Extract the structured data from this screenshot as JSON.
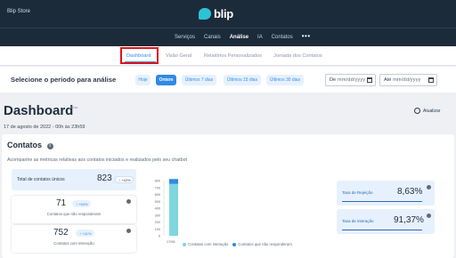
{
  "app": {
    "store_name": "Blip Store",
    "brand": "blip"
  },
  "nav": {
    "items": [
      {
        "label": "Serviços"
      },
      {
        "label": "Canais"
      },
      {
        "label": "Análise"
      },
      {
        "label": "IA"
      },
      {
        "label": "Contatos"
      }
    ],
    "active": "Análise",
    "more": "•••"
  },
  "subtabs": {
    "items": [
      {
        "label": "Dashboard"
      },
      {
        "label": "Visão Geral"
      },
      {
        "label": "Relatórios Personalizados"
      },
      {
        "label": "Jornada dos Contatos"
      }
    ],
    "active": "Dashboard"
  },
  "period": {
    "label": "Selecione o período para análise",
    "chips": [
      {
        "label": "Hoje"
      },
      {
        "label": "Ontem"
      },
      {
        "label": "Últimos 7 dias"
      },
      {
        "label": "Últimos 15 dias"
      },
      {
        "label": "Últimos 30 dias"
      }
    ],
    "active_chip": "Ontem",
    "from_label": "De",
    "from_placeholder": "mm/dd/yyyy",
    "to_label": "Até",
    "to_placeholder": "mm/dd/yyyy"
  },
  "dashboard": {
    "title": "Dashboard",
    "beta": "Beta",
    "date": "17 de agosto de 2022 - 00h às 23h59",
    "refresh_label": "Atualizar"
  },
  "contatos": {
    "title": "Contatos",
    "info": "i",
    "description": "Acompanhe as métricas relativas aos contatos iniciados e realizados pelo seu chatbot",
    "total": {
      "label": "Total de contatos únicos",
      "value": "823",
      "change": "↑ +42%"
    },
    "unanswered": {
      "value": "71",
      "change": "↑ +54%",
      "label": "Contatos que não responderam"
    },
    "interacted": {
      "value": "752",
      "change": "↑ +41%",
      "label": "Contatos com interação"
    },
    "rates": [
      {
        "label": "Taxa de Rejeição",
        "value": "8,63%"
      },
      {
        "label": "Taxa de interação",
        "value": "91,37%"
      }
    ]
  },
  "colors": {
    "interaction": "#7fd6df",
    "unanswered": "#2e8ae5",
    "accent": "#2e8ae5",
    "topbar": "#1c2b3a"
  },
  "chart_data": {
    "type": "bar",
    "categories": [
      "17/08"
    ],
    "series": [
      {
        "name": "Contatos com interação",
        "values": [
          752
        ]
      },
      {
        "name": "Contatos que não responderam",
        "values": [
          71
        ]
      }
    ],
    "ylim": [
      0,
      800
    ],
    "yticks": [
      "800",
      "700",
      "600",
      "500",
      "400",
      "300",
      "200",
      "100",
      "0"
    ],
    "stacked": true,
    "legend": "bottom"
  }
}
